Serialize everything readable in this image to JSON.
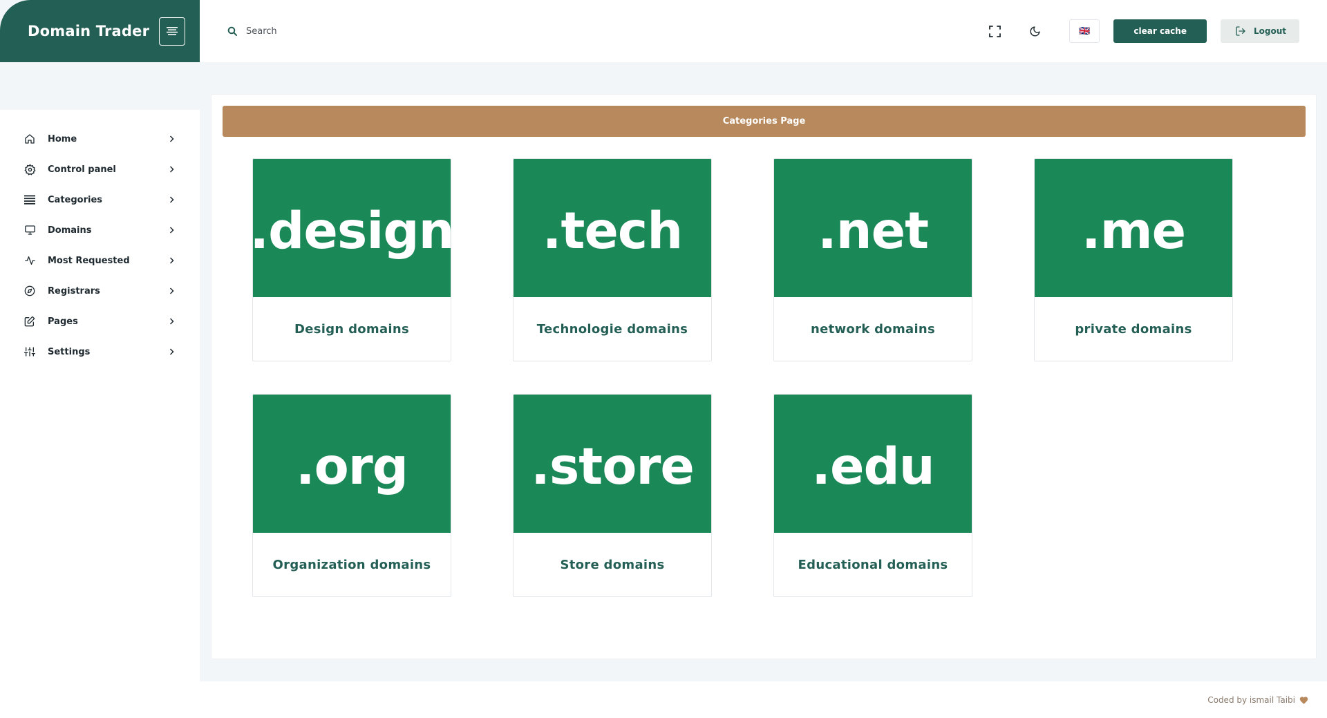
{
  "brand": {
    "title": "Domain Trader"
  },
  "header": {
    "search_placeholder": "Search",
    "clear_cache_label": "clear cache",
    "logout_label": "Logout",
    "language_flag": "🇬🇧"
  },
  "sidebar": {
    "items": [
      {
        "label": "Home",
        "icon": "home-icon"
      },
      {
        "label": "Control panel",
        "icon": "gear-icon"
      },
      {
        "label": "Categories",
        "icon": "list-icon"
      },
      {
        "label": "Domains",
        "icon": "monitor-icon"
      },
      {
        "label": "Most Requested",
        "icon": "activity-icon"
      },
      {
        "label": "Registrars",
        "icon": "compass-icon"
      },
      {
        "label": "Pages",
        "icon": "edit-icon"
      },
      {
        "label": "Settings",
        "icon": "sliders-icon"
      }
    ]
  },
  "main": {
    "banner_title": "Categories Page",
    "categories": [
      {
        "ext": ".design",
        "name": "Design domains"
      },
      {
        "ext": ".tech",
        "name": "Technologie domains"
      },
      {
        "ext": ".net",
        "name": "network domains"
      },
      {
        "ext": ".me",
        "name": "private domains"
      },
      {
        "ext": ".org",
        "name": "Organization domains"
      },
      {
        "ext": ".store",
        "name": "Store domains"
      },
      {
        "ext": ".edu",
        "name": "Educational domains"
      }
    ]
  },
  "footer": {
    "credit": "Coded by ismail Taibi"
  },
  "colors": {
    "primary": "#245f55",
    "tile_green": "#1b8858",
    "banner": "#b8895d",
    "heart": "#b8895d"
  }
}
